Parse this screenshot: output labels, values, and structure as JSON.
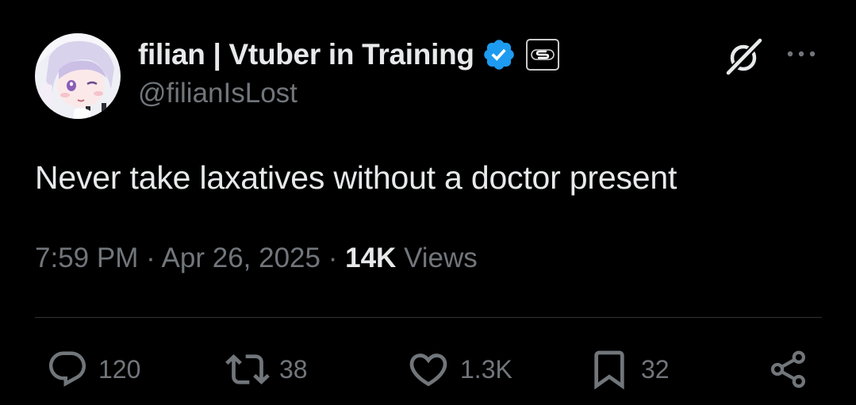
{
  "author": {
    "display_name": "filian | Vtuber in Training",
    "handle": "@filianIsLost",
    "verified": true,
    "avatar": "avatar-image"
  },
  "tweet": {
    "text": "Never take laxatives without a doctor present",
    "time": "7:59 PM",
    "date": "Apr 26, 2025",
    "separator": "·",
    "views_count": "14K",
    "views_label": "Views"
  },
  "actions": {
    "replies": "120",
    "reposts": "38",
    "likes": "1.3K",
    "bookmarks": "32"
  },
  "icons": {
    "verified": "verified-badge-icon",
    "affiliate": "affiliate-badge-icon",
    "grok": "grok-icon",
    "more": "more-options-icon",
    "reply": "reply-icon",
    "repost": "repost-icon",
    "like": "heart-icon",
    "bookmark": "bookmark-icon",
    "share": "share-icon"
  },
  "colors": {
    "background": "#000000",
    "primary_text": "#e7e9ea",
    "secondary_text": "#71767b",
    "verified_blue": "#1d9bf0",
    "divider": "#2f3336"
  }
}
